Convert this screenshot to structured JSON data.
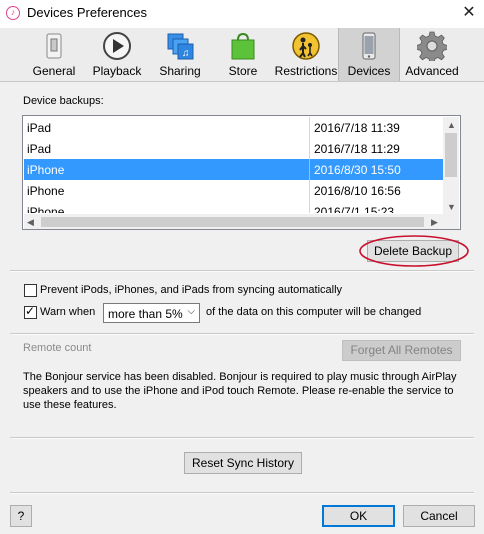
{
  "window": {
    "title": "Devices Preferences"
  },
  "toolbar": {
    "tabs": [
      {
        "label": "General",
        "icon": "switch-icon"
      },
      {
        "label": "Playback",
        "icon": "play-icon"
      },
      {
        "label": "Sharing",
        "icon": "shared-library-icon"
      },
      {
        "label": "Store",
        "icon": "shopping-bag-icon"
      },
      {
        "label": "Restrictions",
        "icon": "parental-controls-icon"
      },
      {
        "label": "Devices",
        "icon": "phone-icon",
        "active": true
      },
      {
        "label": "Advanced",
        "icon": "gear-icon"
      }
    ]
  },
  "backups": {
    "heading": "Device backups:",
    "rows": [
      {
        "name": "iPad",
        "date": "2016/7/18 11:39"
      },
      {
        "name": "iPad",
        "date": "2016/7/18 11:29"
      },
      {
        "name": "iPhone",
        "date": "2016/8/30 15:50",
        "selected": true
      },
      {
        "name": "iPhone",
        "date": "2016/8/10 16:56"
      },
      {
        "name": "iPhone",
        "date": "2016/7/1 15:23"
      }
    ],
    "delete_label": "Delete Backup"
  },
  "options": {
    "prevent_sync_label": "Prevent iPods, iPhones, and iPads from syncing automatically",
    "prevent_sync_checked": false,
    "warn_label": "Warn when",
    "warn_checked": true,
    "warn_threshold": "more than 5%",
    "warn_suffix": "of the data on this computer will be changed"
  },
  "remotes": {
    "count_label": "Remote count",
    "forget_label": "Forget All Remotes",
    "bonjour_message": "The Bonjour service has been disabled. Bonjour is required to play music through AirPlay speakers and to use the iPhone and iPod touch Remote. Please re-enable the service to use these features."
  },
  "reset_sync_label": "Reset Sync History",
  "footer": {
    "help_label": "?",
    "ok_label": "OK",
    "cancel_label": "Cancel"
  },
  "colors": {
    "selection": "#3399ff",
    "annotation_circle": "#c8102e",
    "default_button_border": "#0078d7"
  }
}
